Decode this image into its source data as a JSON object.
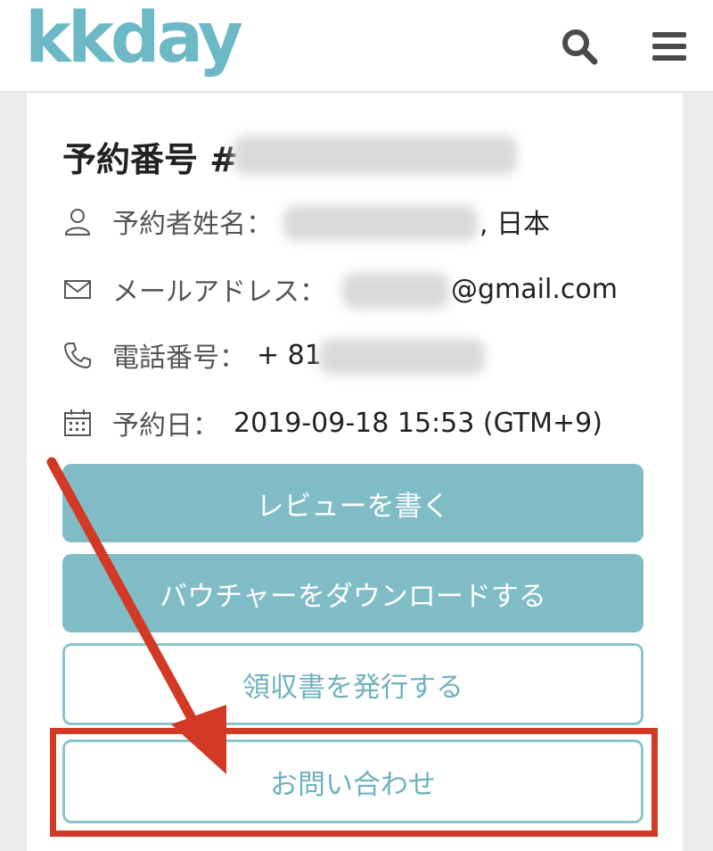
{
  "header": {
    "logo": "kkday",
    "icons": [
      "search-icon",
      "menu-icon"
    ]
  },
  "booking": {
    "title_prefix": "予約番号 #",
    "fields": {
      "name_label": "予約者姓名：",
      "name_suffix": ", 日本",
      "email_label": "メールアドレス：",
      "email_suffix": "@gmail.com",
      "phone_label": "電話番号：",
      "phone_prefix": "+ 81",
      "date_label": "予約日：",
      "date_value": "2019-09-18 15:53 (GTM+9)"
    }
  },
  "buttons": {
    "review": "レビューを書く",
    "voucher": "バウチャーをダウンロードする",
    "receipt": "領収書を発行する",
    "contact": "お問い合わせ"
  },
  "colors": {
    "accent": "#7fbcc6",
    "logo": "#6cb8c4",
    "highlight": "#d33a26"
  }
}
